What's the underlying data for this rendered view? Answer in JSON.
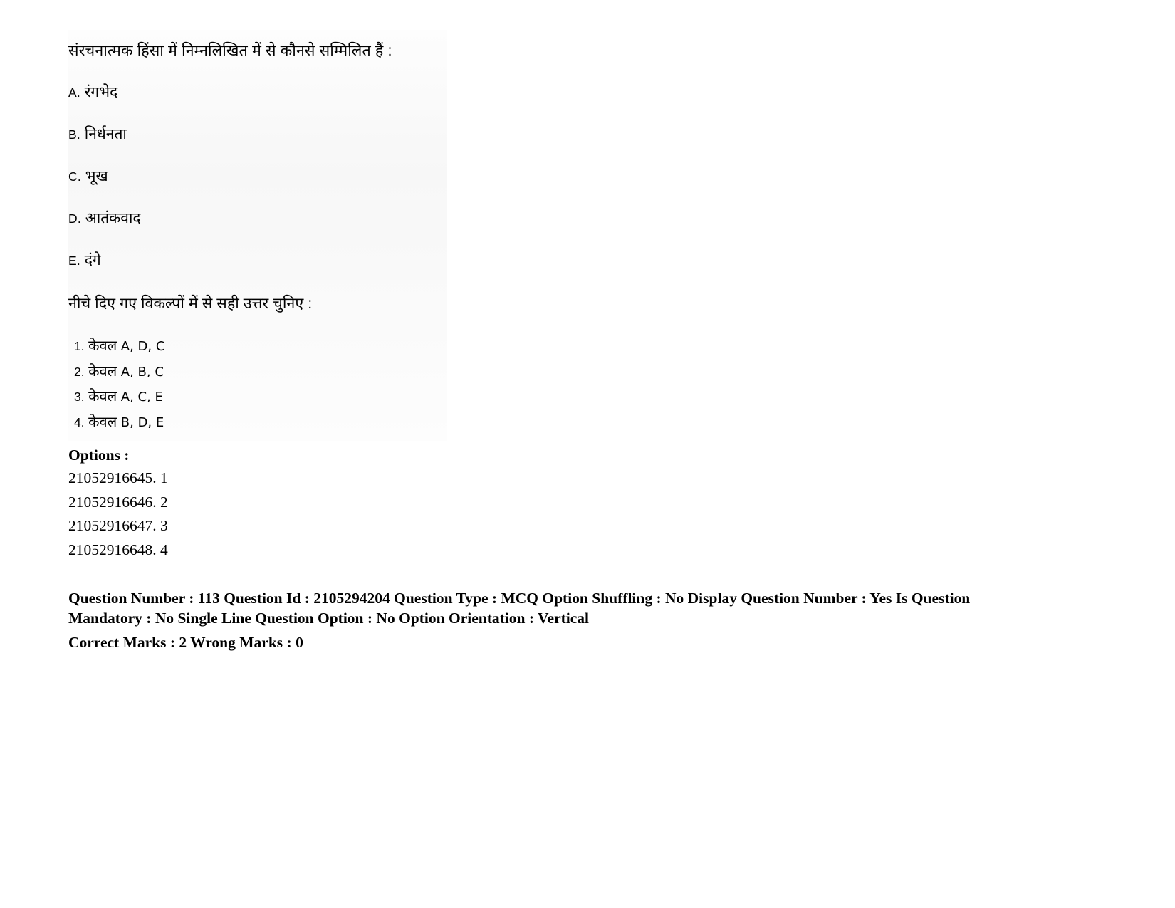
{
  "document": {
    "type": "exam-question-page",
    "language": "Hindi"
  },
  "question": {
    "stem": "संरचनात्मक हिंसा में निम्नलिखित में से कौनसे सम्मिलित हैं :",
    "statements": [
      {
        "label": "A.",
        "text": "रंगभेद"
      },
      {
        "label": "B.",
        "text": "निर्धनता"
      },
      {
        "label": "C.",
        "text": "भूख"
      },
      {
        "label": "D.",
        "text": "आतंकवाद"
      },
      {
        "label": "E.",
        "text": "दंगे"
      }
    ],
    "prompt": "नीचे दिए गए विकल्पों में से सही उत्तर चुनिए :",
    "choices": [
      {
        "num": "1.",
        "prefix": "केवल",
        "items": "A, D, C"
      },
      {
        "num": "2.",
        "prefix": "केवल",
        "items": "A, B, C"
      },
      {
        "num": "3.",
        "prefix": "केवल",
        "items": "A, C, E"
      },
      {
        "num": "4.",
        "prefix": "केवल",
        "items": "B, D, E"
      }
    ]
  },
  "options_section": {
    "heading": "Options :",
    "rows": [
      "21052916645. 1",
      "21052916646. 2",
      "21052916647. 3",
      "21052916648. 4"
    ]
  },
  "metadata": {
    "line1": "Question Number : 113 Question Id : 2105294204 Question Type : MCQ Option Shuffling : No Display Question Number : Yes Is Question Mandatory : No Single Line Question Option : No Option Orientation : Vertical",
    "line2": "Correct Marks : 2 Wrong Marks : 0"
  }
}
